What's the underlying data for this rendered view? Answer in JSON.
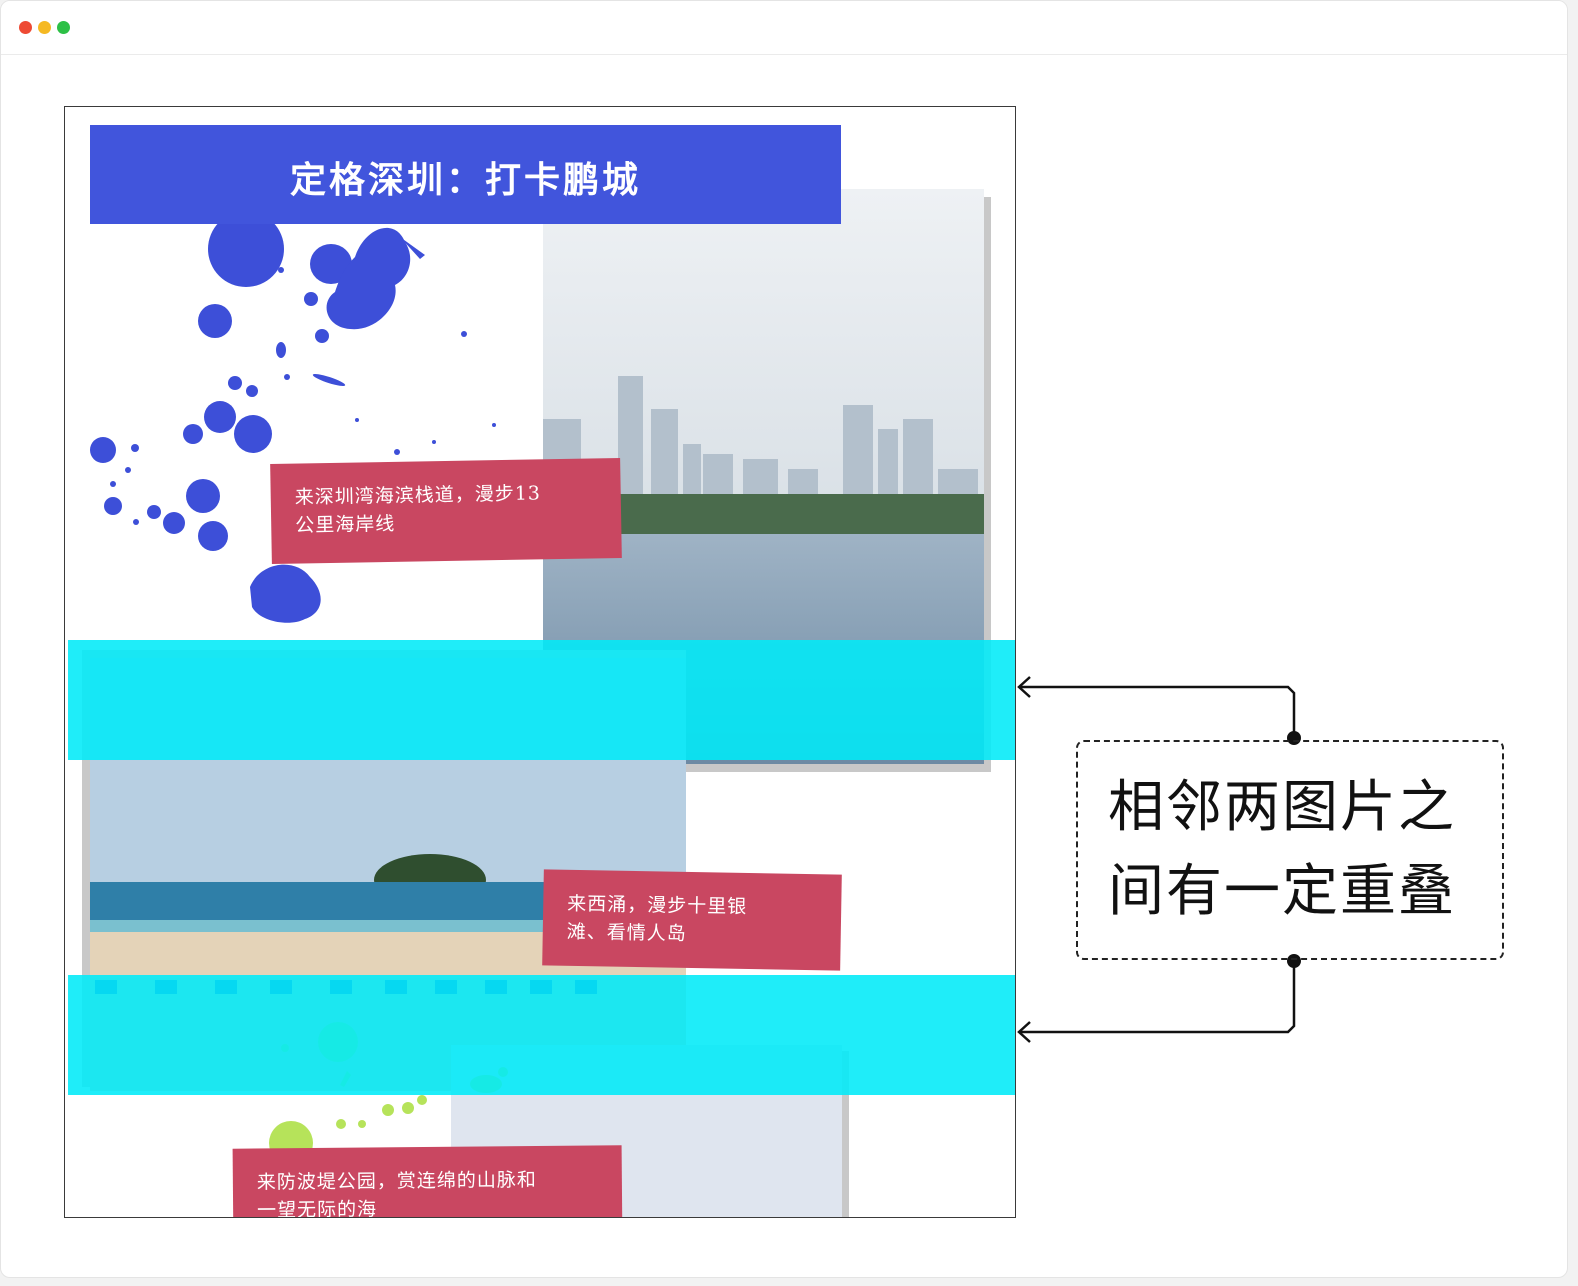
{
  "window": {
    "controls": [
      "close",
      "minimize",
      "maximize"
    ]
  },
  "poster": {
    "title": "定格深圳：打卡鹏城",
    "captions": [
      {
        "line1": "来深圳湾海滨栈道，漫步13",
        "line2": "公里海岸线"
      },
      {
        "line1": "来西涌，漫步十里银",
        "line2": "滩、看情人岛"
      },
      {
        "line1": "来防波堤公园，赏连绵的山脉和",
        "line2": "一望无际的海"
      }
    ],
    "photos": [
      "skyline-over-bay-photo",
      "beach-with-island-photo",
      "sky-photo"
    ],
    "colors": {
      "title_bg": "#4155dc",
      "caption_bg": "#c94761",
      "overlap_highlight": "#00eaf8",
      "splash_blue": "#3d4fd8",
      "splash_green": "#b6e35a"
    }
  },
  "annotation": {
    "line1": "相邻两图片之",
    "line2": "间有一定重叠"
  }
}
